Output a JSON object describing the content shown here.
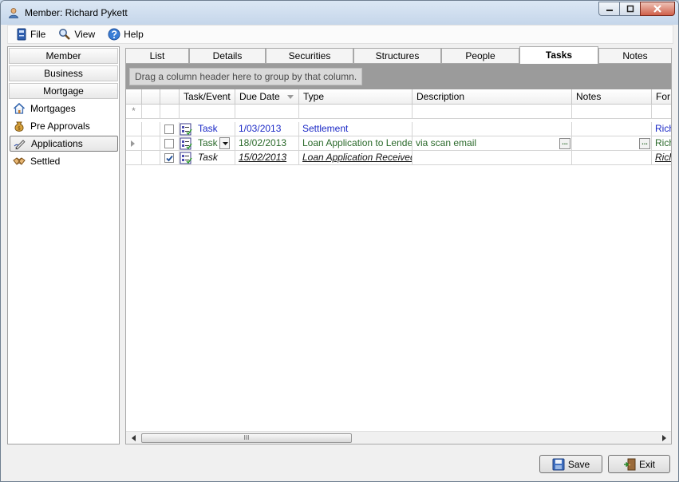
{
  "window": {
    "title": "Member: Richard Pykett"
  },
  "menu": [
    {
      "label": "File",
      "icon": "file-icon"
    },
    {
      "label": "View",
      "icon": "view-icon"
    },
    {
      "label": "Help",
      "icon": "help-icon"
    }
  ],
  "sidebar": {
    "groups": [
      "Member",
      "Business",
      "Mortgage"
    ],
    "items": [
      {
        "label": "Mortgages",
        "icon": "house-icon"
      },
      {
        "label": "Pre Approvals",
        "icon": "money-bag-icon"
      },
      {
        "label": "Applications",
        "icon": "pen-icon",
        "selected": true
      },
      {
        "label": "Settled",
        "icon": "handshake-icon"
      }
    ]
  },
  "tabs": [
    "List",
    "Details",
    "Securities",
    "Structures",
    "People",
    "Tasks",
    "Notes"
  ],
  "active_tab": "Tasks",
  "grid": {
    "group_hint": "Drag a column header here to group by that column.",
    "columns": [
      "Task/Event",
      "Due Date",
      "Type",
      "Description",
      "Notes",
      "For"
    ],
    "new_row_marker": "*",
    "rows": [
      {
        "task": "Task",
        "due": "1/03/2013",
        "type": "Settlement",
        "description": "",
        "notes": "",
        "for": "Rich",
        "checked": false,
        "style": "blue"
      },
      {
        "task": "Task",
        "due": "18/02/2013",
        "type": "Loan Application to Lender",
        "description": "via scan email",
        "notes": "",
        "for": "Rich",
        "checked": false,
        "style": "green",
        "current": true
      },
      {
        "task": "Task",
        "due": "15/02/2013",
        "type": "Loan Application Received",
        "description": "",
        "notes": "",
        "for": "Rich",
        "checked": true,
        "style": "done"
      }
    ],
    "scroll_grip": "III"
  },
  "buttons": {
    "save": "Save",
    "exit": "Exit"
  },
  "colors": {
    "accent_blue": "#1a28c6",
    "green_row": "#2b6a2b",
    "group_bar": "#9b9b9b"
  }
}
